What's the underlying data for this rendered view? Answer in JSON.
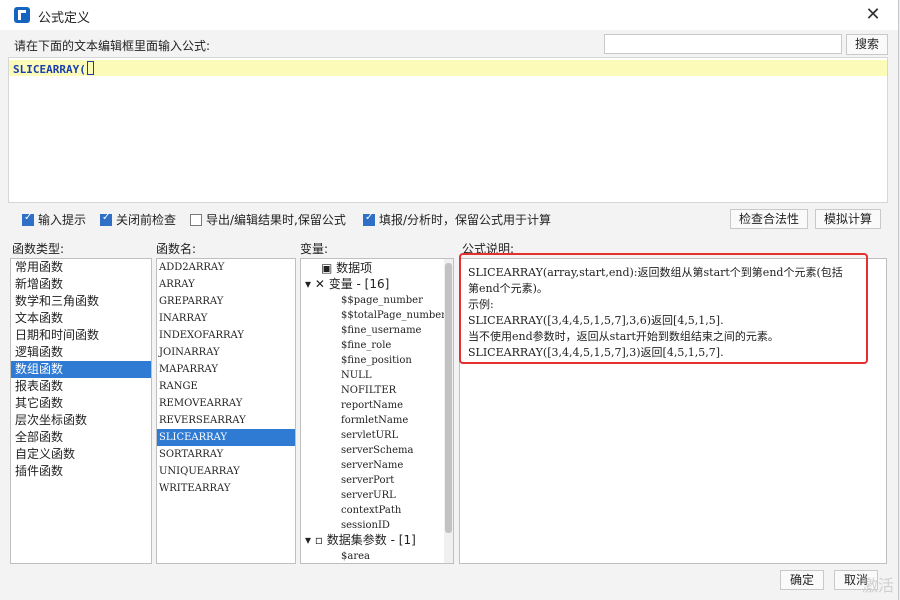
{
  "window": {
    "title": "公式定义",
    "close_symbol": "✕"
  },
  "prompt": "请在下面的文本编辑框里面输入公式:",
  "search": {
    "placeholder": "",
    "button": "搜索"
  },
  "editor": {
    "text": "SLICEARRAY(",
    "cursor_char": ")"
  },
  "options": [
    {
      "label": "输入提示",
      "checked": true
    },
    {
      "label": "关闭前检查",
      "checked": true
    },
    {
      "label": "导出/编辑结果时,保留公式",
      "checked": false
    },
    {
      "label": "填报/分析时，保留公式用于计算",
      "checked": true
    }
  ],
  "toolbar": {
    "check_validity": "检查合法性",
    "simulate": "模拟计算"
  },
  "sections": {
    "category": "函数类型:",
    "function": "函数名:",
    "variable": "变量:",
    "description": "公式说明:"
  },
  "categories": [
    "常用函数",
    "新增函数",
    "数学和三角函数",
    "文本函数",
    "日期和时间函数",
    "逻辑函数",
    "数组函数",
    "报表函数",
    "其它函数",
    "层次坐标函数",
    "全部函数",
    "自定义函数",
    "插件函数"
  ],
  "selected_category": "数组函数",
  "functions": [
    "ADD2ARRAY",
    "ARRAY",
    "GREPARRAY",
    "INARRAY",
    "INDEXOFARRAY",
    "JOINARRAY",
    "MAPARRAY",
    "RANGE",
    "REMOVEARRAY",
    "REVERSEARRAY",
    "SLICEARRAY",
    "SORTARRAY",
    "UNIQUEARRAY",
    "WRITEARRAY"
  ],
  "selected_function": "SLICEARRAY",
  "variables": {
    "data_item": "数据项",
    "var_group": "变量 - [16]",
    "vars": [
      "$$page_number",
      "$$totalPage_number",
      "$fine_username",
      "$fine_role",
      "$fine_position",
      "NULL",
      "NOFILTER",
      "reportName",
      "formletName",
      "servletURL",
      "serverSchema",
      "serverName",
      "serverPort",
      "serverURL",
      "contextPath",
      "sessionID"
    ],
    "dataset_group": "数据集参数 - [1]",
    "dataset_params": [
      "$area"
    ]
  },
  "description": [
    "SLICEARRAY(array,start,end):返回数组从第start个到第end个元素(包括",
    "第end个元素)。",
    "示例:",
    "SLICEARRAY([3,4,4,5,1,5,7],3,6)返回[4,5,1,5].",
    "当不使用end参数时，返回从start开始到数组结束之间的元素。",
    "SLICEARRAY([3,4,4,5,1,5,7],3)返回[4,5,1,5,7]."
  ],
  "footer": {
    "ok": "确定",
    "cancel": "取消"
  },
  "watermark": "激活",
  "colors": {
    "selection": "#2f7ad3",
    "highlight_border": "#e53030",
    "editor_line": "#fdfbb8"
  }
}
